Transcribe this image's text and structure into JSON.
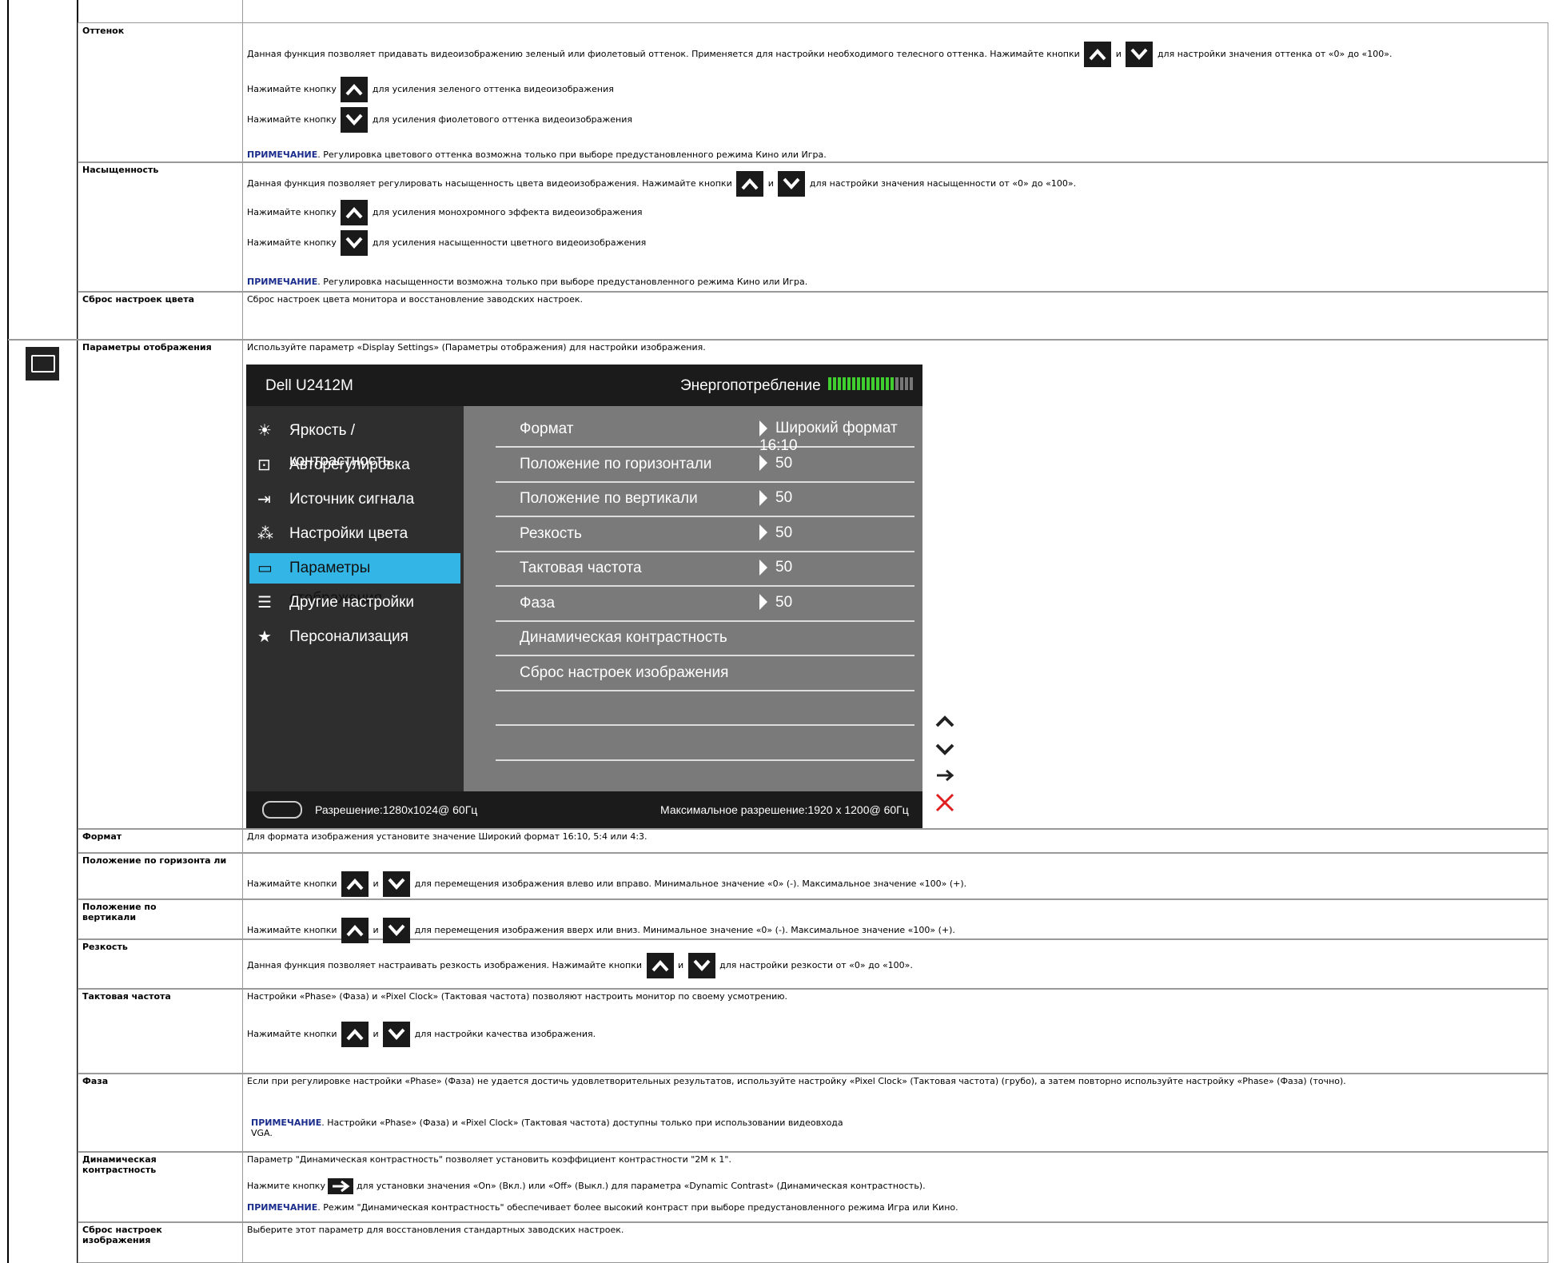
{
  "rows": {
    "hue": {
      "label": "Оттенок",
      "p1": "Данная функция позволяет придавать видеоизображению зеленый или фиолетовый оттенок. Применяется для настройки необходимого телесного оттенка. Нажимайте кнопки",
      "p1_and": "и",
      "p1_end": "для настройки значения оттенка от «0» до «100».",
      "p2_a": "Нажимайте кнопку",
      "p2_b": "для усиления зеленого оттенка видеоизображения",
      "p3_a": "Нажимайте кнопку",
      "p3_b": "для усиления фиолетового оттенка видеоизображения",
      "note_label": "ПРИМЕЧАНИЕ",
      "note": ". Регулировка цветового оттенка возможна только при выборе предустановленного режима Кино или Игра."
    },
    "saturation": {
      "label": "Насыщенность",
      "p1": "Данная функция позволяет регулировать насыщенность цвета видеоизображения. Нажимайте кнопки",
      "p1_and": "и",
      "p1_end": "для настройки значения насыщенности от «0» до «100».",
      "p2_a": "Нажимайте кнопку",
      "p2_b": "для усиления монохромного эффекта видеоизображения",
      "p3_a": "Нажимайте кнопку",
      "p3_b": "для усиления насыщенности цветного видеоизображения",
      "note_label": "ПРИМЕЧАНИЕ",
      "note": ". Регулировка насыщенности возможна только при выборе предустановленного режима Кино или Игра."
    },
    "color_reset": {
      "label": "Сброс настроек цвета",
      "text": "Сброс настроек цвета монитора и восстановление заводских настроек."
    },
    "display_settings": {
      "label": "Параметры отображения",
      "text": "Используйте параметр «Display Settings» (Параметры отображения) для настройки изображения."
    },
    "format": {
      "label": "Формат",
      "text": "Для формата изображения установите значение Широкий формат 16:10, 5:4 или 4:3."
    },
    "hpos": {
      "label": "Положение по горизонта ли",
      "text_a": "Нажимайте кнопки",
      "and": "и",
      "text_b": "для перемещения изображения влево или вправо. Минимальное значение «0» (-). Максимальное значение «100» (+)."
    },
    "vpos": {
      "label": "Положение по вертикали",
      "text_a": "Нажимайте кнопки",
      "and": "и",
      "text_b": "для перемещения изображения вверх или вниз. Минимальное значение «0» (-). Максимальное значение «100» (+)."
    },
    "sharpness": {
      "label": "Резкость",
      "text_a": "Данная функция позволяет настраивать резкость изображения. Нажимайте кнопки",
      "and": "и",
      "text_b": "для настройки резкости от «0» до «100»."
    },
    "clock": {
      "label": "Тактовая частота",
      "p1": "Настройки «Phase» (Фаза) и «Pixel Clock» (Тактовая частота) позволяют настроить монитор по своему усмотрению.",
      "p2_a": "Нажимайте кнопки",
      "and": "и",
      "p2_b": "для настройки качества изображения."
    },
    "phase": {
      "label": "Фаза",
      "p1": "Если при регулировке настройки «Phase» (Фаза) не удается достичь удовлетворительных результатов, используйте настройку «Pixel Clock» (Тактовая частота) (грубо), а затем повторно используйте настройку «Phase» (Фаза) (точно).",
      "note_label": "ПРИМЕЧАНИЕ",
      "note": ". Настройки «Phase» (Фаза) и «Pixel Clock» (Тактовая частота) доступны только при использовании видеовхода",
      "note2": "VGA."
    },
    "dyn_contrast": {
      "label": "Динамическая контрастность",
      "p1": "Параметр \"Динамическая контрастность\" позволяет установить коэффициент контрастности \"2М к 1\".",
      "p2_a": "Нажмите кнопку",
      "p2_b": "для установки значения «On» (Вкл.) или «Off» (Выкл.) для параметра «Dynamic Contrast» (Динамическая контрастность).",
      "note_label": "ПРИМЕЧАНИЕ",
      "note": ". Режим \"Динамическая контрастность\" обеспечивает более высокий контраст при выборе предустановленного режима Игра или Кино."
    },
    "image_reset": {
      "label": "Сброс настроек изображения",
      "text": "Выберите этот параметр для восстановления стандартных заводских настроек."
    }
  },
  "osd": {
    "model": "Dell U2412M",
    "power_label": "Энергопотребление",
    "power_level": 0.8,
    "menu": [
      {
        "label": "Яркость / контрастность",
        "icon": "brightness-icon"
      },
      {
        "label": "Авторегулировка",
        "icon": "auto-adjust-icon"
      },
      {
        "label": "Источник сигнала",
        "icon": "input-source-icon"
      },
      {
        "label": "Настройки цвета",
        "icon": "color-settings-icon"
      },
      {
        "label": "Параметры отображения",
        "icon": "display-settings-icon",
        "active": true
      },
      {
        "label": "Другие настройки",
        "icon": "other-settings-icon"
      },
      {
        "label": "Персонализация",
        "icon": "star-icon"
      }
    ],
    "submenu": [
      {
        "label": "Формат",
        "value": "Широкий формат  16:10"
      },
      {
        "label": "Положение по горизонтали",
        "value": "50"
      },
      {
        "label": "Положение по вертикали",
        "value": "50"
      },
      {
        "label": "Резкость",
        "value": "50"
      },
      {
        "label": "Тактовая частота",
        "value": "50"
      },
      {
        "label": "Фаза",
        "value": "50"
      },
      {
        "label": "Динамическая контрастность",
        "value": ""
      },
      {
        "label": "Сброс настроек изображения",
        "value": ""
      }
    ],
    "resolution": "Разрешение:1280x1024@ 60Гц",
    "max_resolution": "Максимальное разрешение:1920 x 1200@ 60Гц"
  }
}
